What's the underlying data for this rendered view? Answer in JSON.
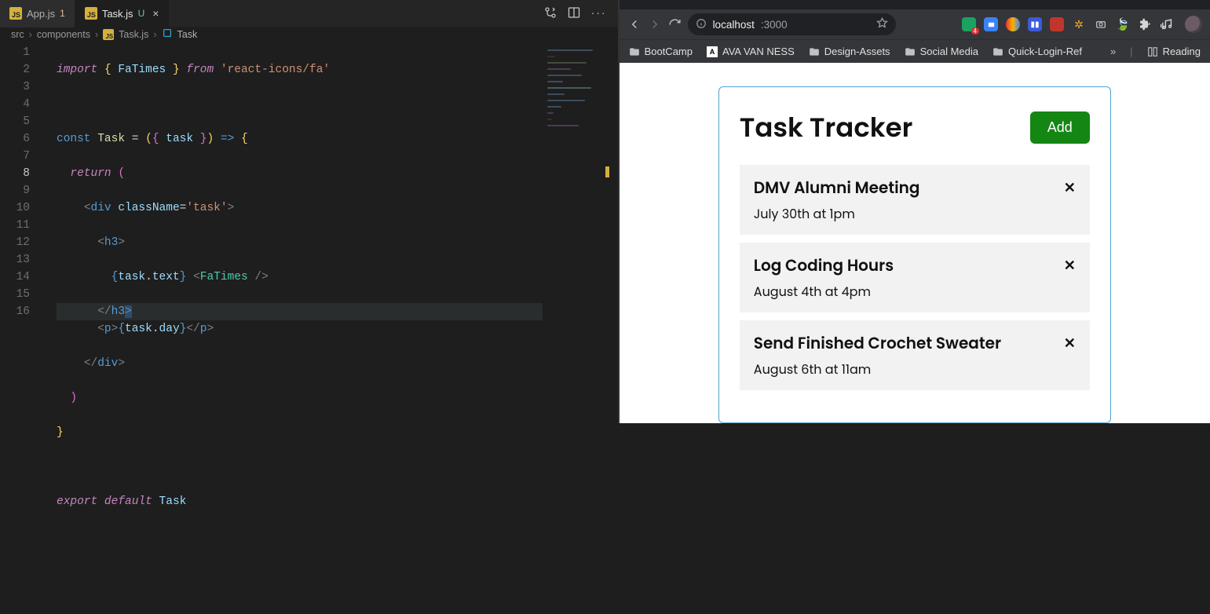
{
  "editor": {
    "tabs": [
      {
        "name": "App.js",
        "badge": "1",
        "marker": ""
      },
      {
        "name": "Task.js",
        "badge": "",
        "marker": "U"
      }
    ],
    "breadcrumbs": {
      "folder1": "src",
      "folder2": "components",
      "file": "Task.js",
      "symbol": "Task"
    },
    "code": {
      "l1_import": "import",
      "l1_brace1": "{",
      "l1_id": " FaTimes ",
      "l1_brace2": "}",
      "l1_from": "from",
      "l1_str": "'react-icons/fa'",
      "l3_const": "const",
      "l3_name": " Task ",
      "l3_eq": "= ",
      "l3_p1": "(",
      "l3_b1": "{",
      "l3_arg": " task ",
      "l3_b2": "}",
      "l3_p2": ")",
      "l3_arrow": " => ",
      "l3_open": "{",
      "l4_return": "return",
      "l4_paren": " (",
      "l5_open": "<",
      "l5_div": "div",
      "l5_attr": " className",
      "l5_eq": "=",
      "l5_val": "'task'",
      "l5_close": ">",
      "l6_open": "<",
      "l6_h3": "h3",
      "l6_close": ">",
      "l7_b1": "{",
      "l7_obj": "task",
      "l7_dot": ".",
      "l7_prop": "text",
      "l7_b2": "}",
      "l7_sp": " ",
      "l7_lt": "<",
      "l7_comp": "FaTimes",
      "l7_slash": " />",
      "l8_open": "</",
      "l8_h3": "h3",
      "l8_close": ">",
      "l9_open": "<",
      "l9_p": "p",
      "l9_gt": ">",
      "l9_b1": "{",
      "l9_obj": "task",
      "l9_dot": ".",
      "l9_prop": "day",
      "l9_b2": "}",
      "l9_co": "</",
      "l9_pp": "p",
      "l9_cc": ">",
      "l10_open": "</",
      "l10_div": "div",
      "l10_close": ">",
      "l11_paren": ")",
      "l12_brace": "}",
      "l14_export": "export",
      "l14_default": " default",
      "l14_name": " Task"
    },
    "line_numbers": [
      "1",
      "2",
      "3",
      "4",
      "5",
      "6",
      "7",
      "8",
      "9",
      "10",
      "11",
      "12",
      "13",
      "14",
      "15",
      "16"
    ]
  },
  "browser": {
    "url_host": "localhost",
    "url_port": ":3000",
    "ext_badge": "4",
    "bookmarks": {
      "b1": "BootCamp",
      "b2": "AVA VAN NESS",
      "b3": "Design-Assets",
      "b4": "Social Media",
      "b5": "Quick-Login-Ref",
      "reading": "Reading"
    },
    "app": {
      "title": "Task Tracker",
      "add": "Add",
      "tasks": [
        {
          "text": "DMV Alumni Meeting",
          "day": "July 30th at 1pm"
        },
        {
          "text": "Log Coding Hours",
          "day": "August 4th at 4pm"
        },
        {
          "text": "Send Finished Crochet Sweater",
          "day": "August 6th at 11am"
        }
      ]
    }
  }
}
